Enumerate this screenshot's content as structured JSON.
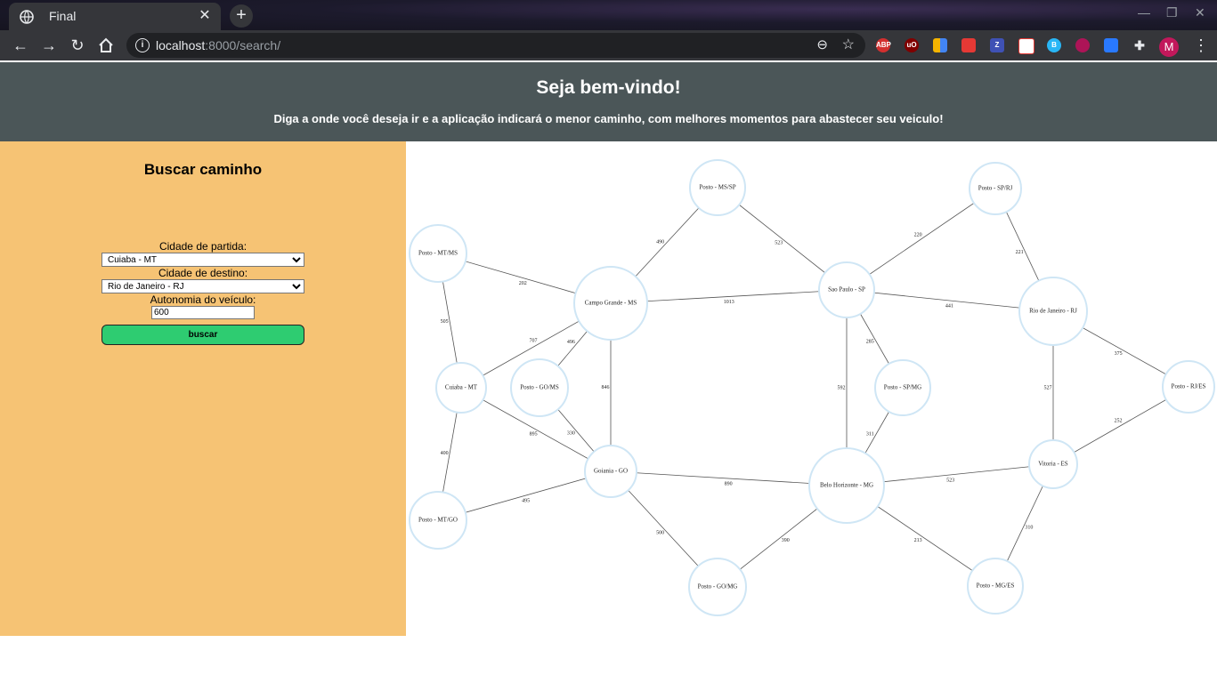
{
  "browser": {
    "tab_title": "Final",
    "url_host": "localhost",
    "url_rest": ":8000/search/",
    "extensions": [
      "ABP",
      "uO",
      "Z",
      "B",
      "M"
    ]
  },
  "header": {
    "title": "Seja bem-vindo!",
    "subtitle": "Diga a onde você deseja ir e a aplicação indicará o menor caminho, com melhores momentos para abastecer seu veiculo!"
  },
  "search": {
    "title": "Buscar caminho",
    "origin_label": "Cidade de partida:",
    "origin_value": "Cuiaba - MT",
    "destination_label": "Cidade de destino:",
    "destination_value": "Rio de Janeiro - RJ",
    "autonomy_label": "Autonomia do veículo:",
    "autonomy_value": "600",
    "button_label": "buscar"
  },
  "graph": {
    "nodes": [
      {
        "id": "mtms",
        "label": "Posto - MT/MS"
      },
      {
        "id": "msp",
        "label": "Posto - MS/SP"
      },
      {
        "id": "sprj",
        "label": "Posto - SP/RJ"
      },
      {
        "id": "cg",
        "label": "Campo Grande - MS"
      },
      {
        "id": "sp",
        "label": "Sao Paulo - SP"
      },
      {
        "id": "rj",
        "label": "Rio de Janeiro - RJ"
      },
      {
        "id": "cui",
        "label": "Cuiaba - MT"
      },
      {
        "id": "goms",
        "label": "Posto - GO/MS"
      },
      {
        "id": "spmg",
        "label": "Posto - SP/MG"
      },
      {
        "id": "rjes",
        "label": "Posto - RJ/ES"
      },
      {
        "id": "gyn",
        "label": "Goiania - GO"
      },
      {
        "id": "bh",
        "label": "Belo Horizonte - MG"
      },
      {
        "id": "vix",
        "label": "Vitoria - ES"
      },
      {
        "id": "mtgo",
        "label": "Posto - MT/GO"
      },
      {
        "id": "gomg",
        "label": "Posto - GO/MG"
      },
      {
        "id": "mges",
        "label": "Posto - MG/ES"
      }
    ],
    "edges": [
      {
        "from": "mtms",
        "to": "cg",
        "label": "202"
      },
      {
        "from": "mtms",
        "to": "cui",
        "label": "505"
      },
      {
        "from": "msp",
        "to": "cg",
        "label": "490"
      },
      {
        "from": "msp",
        "to": "sp",
        "label": "523"
      },
      {
        "from": "sprj",
        "to": "sp",
        "label": "220"
      },
      {
        "from": "sprj",
        "to": "rj",
        "label": "221"
      },
      {
        "from": "cg",
        "to": "sp",
        "label": "1013"
      },
      {
        "from": "sp",
        "to": "rj",
        "label": "441"
      },
      {
        "from": "cg",
        "to": "cui",
        "label": "707"
      },
      {
        "from": "cg",
        "to": "goms",
        "label": "496"
      },
      {
        "from": "cg",
        "to": "gyn",
        "label": "846"
      },
      {
        "from": "sp",
        "to": "spmg",
        "label": "285"
      },
      {
        "from": "sp",
        "to": "bh",
        "label": "592"
      },
      {
        "from": "rj",
        "to": "rjes",
        "label": "375"
      },
      {
        "from": "rj",
        "to": "vix",
        "label": "527"
      },
      {
        "from": "cui",
        "to": "gyn",
        "label": "895"
      },
      {
        "from": "goms",
        "to": "gyn",
        "label": "330"
      },
      {
        "from": "spmg",
        "to": "bh",
        "label": "311"
      },
      {
        "from": "rjes",
        "to": "vix",
        "label": "252"
      },
      {
        "from": "cui",
        "to": "mtgo",
        "label": "400"
      },
      {
        "from": "mtgo",
        "to": "gyn",
        "label": "495"
      },
      {
        "from": "gyn",
        "to": "bh",
        "label": "890"
      },
      {
        "from": "bh",
        "to": "vix",
        "label": "523"
      },
      {
        "from": "gyn",
        "to": "gomg",
        "label": "500"
      },
      {
        "from": "gomg",
        "to": "bh",
        "label": "390"
      },
      {
        "from": "bh",
        "to": "mges",
        "label": "213"
      },
      {
        "from": "mges",
        "to": "vix",
        "label": "310"
      }
    ]
  }
}
